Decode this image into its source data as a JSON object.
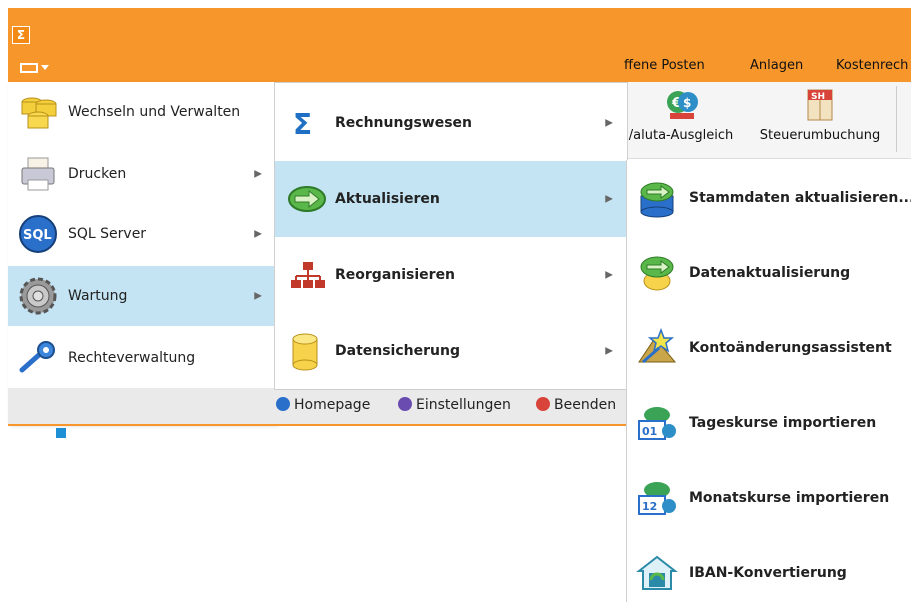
{
  "app": {
    "icon_glyph": "Σ"
  },
  "ribbon": {
    "tabs": [
      "ffene Posten",
      "Anlagen",
      "Kostenrech"
    ],
    "buttons": [
      {
        "label": "/aluta-Ausgleich",
        "icon": "currency-exchange-icon"
      },
      {
        "label": "Steuerumbuchung",
        "icon": "tax-sh-icon"
      }
    ]
  },
  "main_menu": {
    "items": [
      {
        "label": "Wechseln und Verwalten",
        "icon": "database-stack-icon",
        "has_submenu": false
      },
      {
        "label": "Drucken",
        "icon": "printer-icon",
        "has_submenu": true
      },
      {
        "label": "SQL Server",
        "icon": "sql-icon",
        "has_submenu": true
      },
      {
        "label": "Wartung",
        "icon": "gear-icon",
        "has_submenu": true,
        "active": true
      },
      {
        "label": "Rechteverwaltung",
        "icon": "key-icon",
        "has_submenu": false
      }
    ],
    "footer": [
      {
        "label": "Homepage",
        "icon": "globe-icon",
        "color": "#2a6fc9"
      },
      {
        "label": "Einstellungen",
        "icon": "settings-icon",
        "color": "#6a4bb0"
      },
      {
        "label": "Beenden",
        "icon": "exit-icon",
        "color": "#d8443a"
      }
    ]
  },
  "submenu": {
    "items": [
      {
        "label": "Rechnungswesen",
        "icon": "sigma-icon"
      },
      {
        "label": "Aktualisieren",
        "icon": "refresh-icon",
        "active": true
      },
      {
        "label": "Reorganisieren",
        "icon": "hierarchy-icon"
      },
      {
        "label": "Datensicherung",
        "icon": "cylinder-icon"
      }
    ]
  },
  "subsubmenu": {
    "items": [
      {
        "label": "Stammdaten aktualisieren...",
        "icon": "refresh-database-icon"
      },
      {
        "label": "Datenaktualisierung",
        "icon": "refresh-yellow-icon"
      },
      {
        "label": "Kontoänderungsassistent",
        "icon": "wizard-icon"
      },
      {
        "label": "Tageskurse importieren",
        "icon": "daily-rates-icon"
      },
      {
        "label": "Monatskurse importieren",
        "icon": "monthly-rates-icon"
      },
      {
        "label": "IBAN-Konvertierung",
        "icon": "iban-icon"
      }
    ]
  },
  "colors": {
    "accent": "#f7962a",
    "highlight": "#c4e4f3"
  }
}
